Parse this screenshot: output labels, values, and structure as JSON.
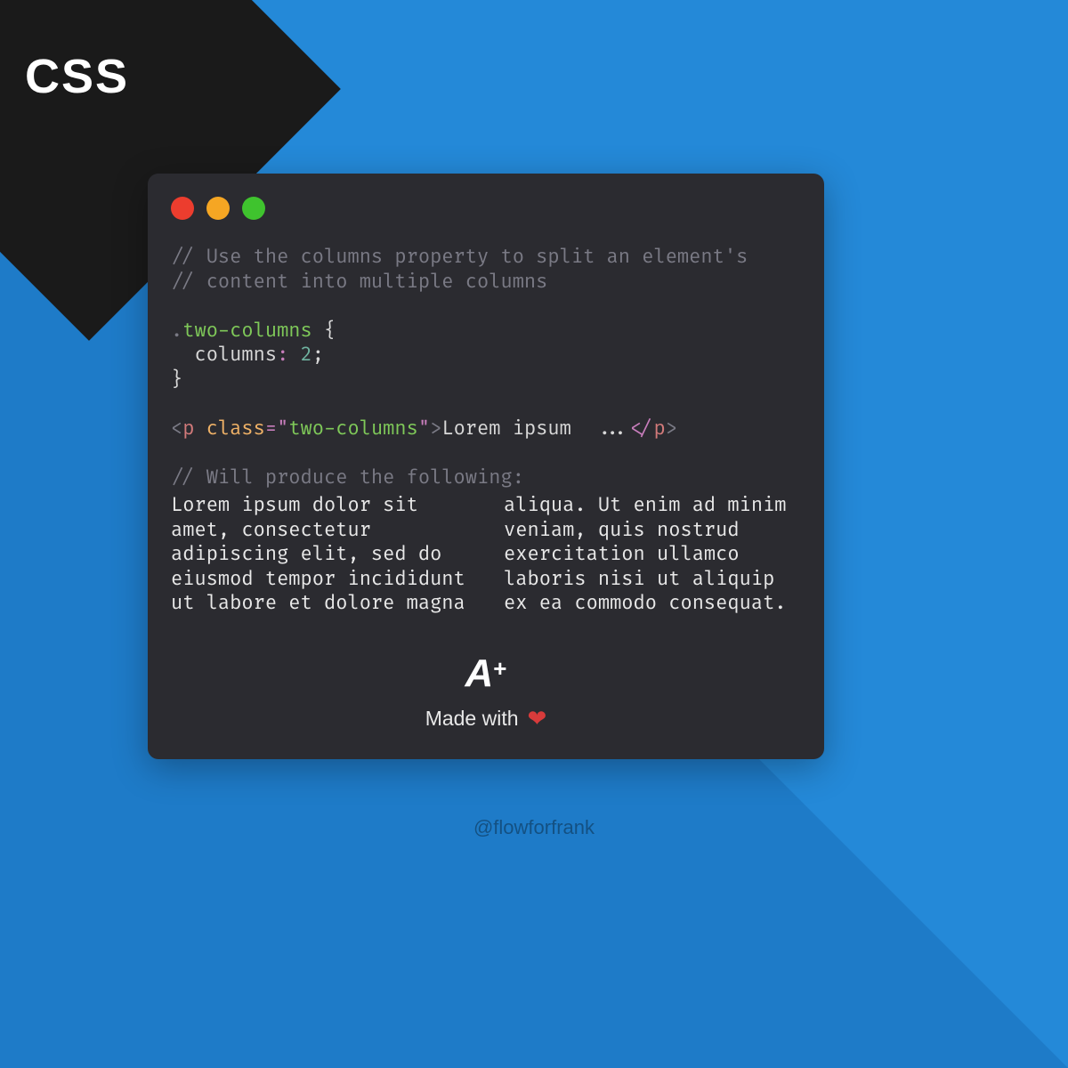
{
  "badge": {
    "label": "CSS"
  },
  "code": {
    "comment1": "// Use the columns property to split an element's",
    "comment2": "// content into multiple columns",
    "selector": "two-columns",
    "property": "columns",
    "value": "2",
    "tag": "p",
    "attr": "class",
    "attrValue": "two-columns",
    "innerText": "Lorem ipsum  ...",
    "comment3": "// Will produce the following:"
  },
  "demo": {
    "text": "Lorem ipsum dolor sit amet, consectetur adipiscing elit, sed do eiusmod tempor incididunt ut labore et dolore magna aliqua. Ut enim ad minim veniam, quis nostrud exercitation ullamco laboris nisi ut aliquip ex ea commodo consequat."
  },
  "footer": {
    "logoA": "A",
    "logoPlus": "+",
    "madeWith": "Made with",
    "heart": "❤"
  },
  "handle": "@flowforfrank"
}
